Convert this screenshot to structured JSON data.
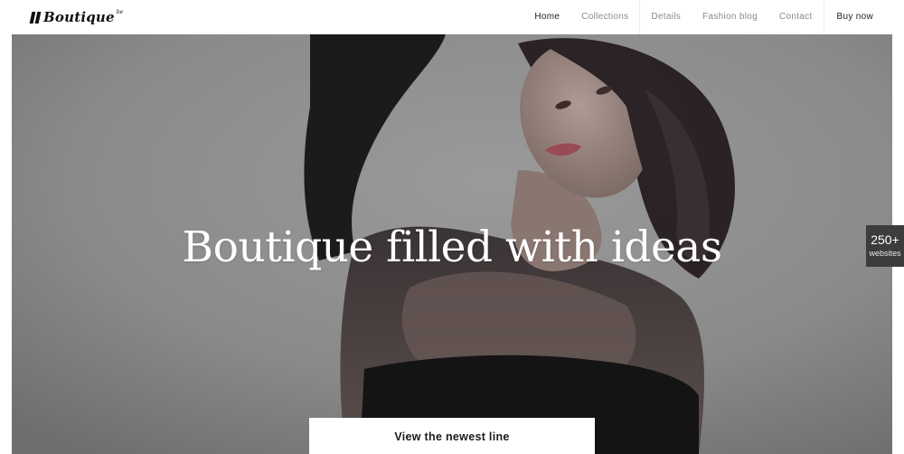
{
  "header": {
    "logo": {
      "text": "Boutique",
      "sup": "be",
      "mark_icon": "double-slash-icon"
    },
    "nav": [
      {
        "label": "Home",
        "active": true
      },
      {
        "label": "Collections",
        "active": false
      },
      {
        "label": "Details",
        "active": false
      },
      {
        "label": "Fashion blog",
        "active": false
      },
      {
        "label": "Contact",
        "active": false
      },
      {
        "label": "Buy now",
        "active": false
      }
    ]
  },
  "hero": {
    "title": "Boutique filled with ideas",
    "cta_label": "View the newest line",
    "image_subject": "model-photo"
  },
  "side_badge": {
    "count": "250+",
    "label": "websites"
  },
  "colors": {
    "nav_text": "#8a8a8a",
    "nav_active": "#222222",
    "hero_bg": "#8c8c8c",
    "badge_bg": "#3c3c3c",
    "title": "#ffffff"
  }
}
